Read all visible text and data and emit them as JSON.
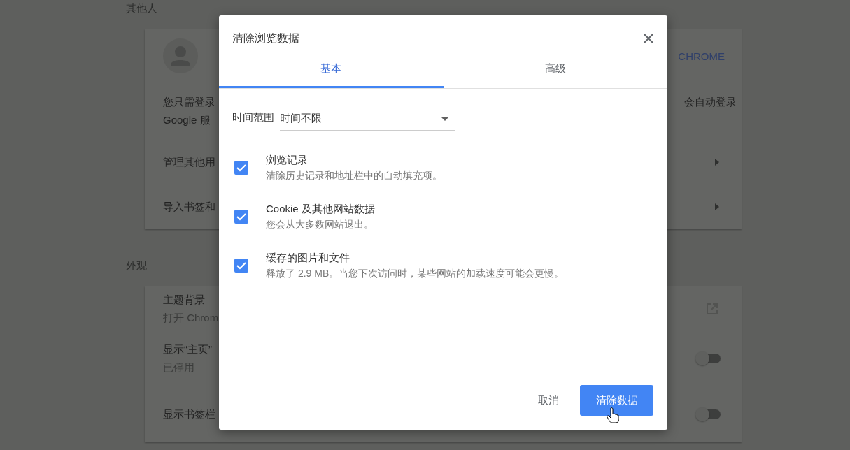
{
  "background": {
    "sections": [
      {
        "heading": "其他人",
        "rows": [
          {
            "kind": "profile",
            "action": "CHROME"
          },
          {
            "kind": "text",
            "lines": [
              "您只需登录",
              "Google 服"
            ],
            "right": "会自动登录"
          },
          {
            "kind": "link",
            "text": "管理其他用"
          },
          {
            "kind": "link",
            "text": "导入书签和"
          }
        ]
      },
      {
        "heading": "外观",
        "rows": [
          {
            "kind": "external",
            "text": "主题背景",
            "secondary": "打开 Chrom"
          },
          {
            "kind": "toggle",
            "text": "显示“主页”",
            "secondary": "已停用",
            "on": false
          },
          {
            "kind": "toggle",
            "text": "显示书签栏",
            "on": false
          }
        ]
      }
    ]
  },
  "dialog": {
    "title": "清除浏览数据",
    "tabs": [
      {
        "label": "基本",
        "selected": true
      },
      {
        "label": "高级",
        "selected": false
      }
    ],
    "time_range": {
      "label": "时间范围",
      "value": "时间不限"
    },
    "options": [
      {
        "title": "浏览记录",
        "description": "清除历史记录和地址栏中的自动填充项。",
        "checked": true
      },
      {
        "title": "Cookie 及其他网站数据",
        "description": "您会从大多数网站退出。",
        "checked": true
      },
      {
        "title": "缓存的图片和文件",
        "description": "释放了 2.9 MB。当您下次访问时，某些网站的加载速度可能会更慢。",
        "checked": true
      }
    ],
    "buttons": [
      {
        "label": "取消",
        "kind": "text"
      },
      {
        "label": "清除数据",
        "kind": "primary"
      }
    ]
  }
}
